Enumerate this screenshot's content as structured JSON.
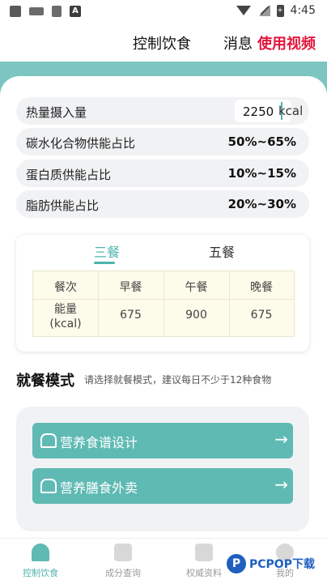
{
  "status_bar": {
    "time": "4:45",
    "battery_icon_glyph": "+"
  },
  "header": {
    "title": "控制饮食",
    "message": "消息",
    "video": "使用视频"
  },
  "settings": {
    "calorie_label": "热量摄入量",
    "calorie_value": "2250",
    "calorie_unit": "kcal",
    "rows": [
      {
        "label": "碳水化合物供能占比",
        "value": "50%~65%"
      },
      {
        "label": "蛋白质供能占比",
        "value": "10%~15%"
      },
      {
        "label": "脂肪供能占比",
        "value": "20%~30%"
      }
    ]
  },
  "meal_card": {
    "tabs": [
      {
        "label": "三餐",
        "active": true
      },
      {
        "label": "五餐",
        "active": false
      }
    ],
    "table": {
      "headers": [
        "餐次",
        "早餐",
        "午餐",
        "晚餐"
      ],
      "row_label": "能量\n(kcal)",
      "values": [
        "675",
        "900",
        "675"
      ]
    }
  },
  "dining_mode": {
    "title": "就餐模式",
    "hint": "请选择就餐模式，建议每日不少于12种食物",
    "buttons": [
      {
        "label": "营养食谱设计",
        "arrow": "→"
      },
      {
        "label": "营养膳食外卖",
        "arrow": "→"
      }
    ]
  },
  "bottom_nav": [
    {
      "label": "控制饮食",
      "active": true
    },
    {
      "label": "成分查询",
      "active": false
    },
    {
      "label": "权威资料",
      "active": false
    },
    {
      "label": "我的",
      "active": false
    }
  ],
  "watermark": {
    "logo": "P",
    "text": "PCPOP下载"
  },
  "colors": {
    "accent": "#4fb4ad",
    "button": "#5fbab4",
    "band": "#7cc5c0",
    "video_red": "#e2163c"
  }
}
